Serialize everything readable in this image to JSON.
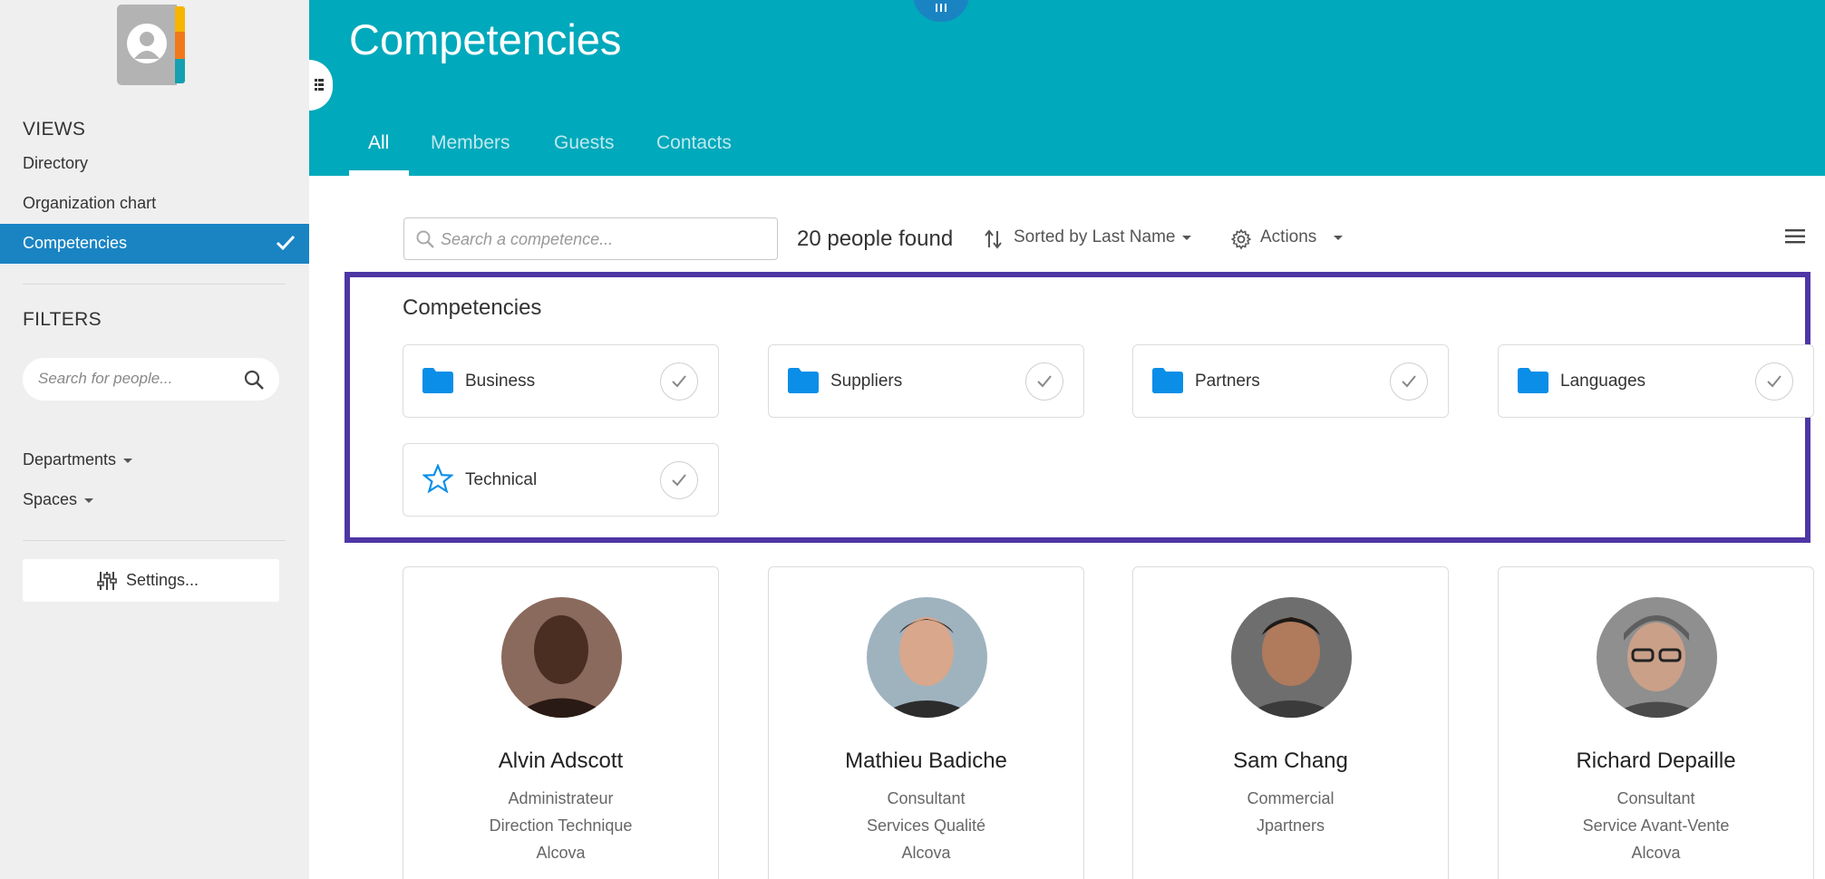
{
  "sidebar": {
    "views_heading": "VIEWS",
    "views": [
      {
        "label": "Directory"
      },
      {
        "label": "Organization chart"
      },
      {
        "label": "Competencies",
        "active": true
      }
    ],
    "filters_heading": "FILTERS",
    "search_placeholder": "Search for people...",
    "dropdowns": [
      {
        "label": "Departments"
      },
      {
        "label": "Spaces"
      }
    ],
    "settings_label": "Settings..."
  },
  "header": {
    "title": "Competencies",
    "tabs": [
      {
        "label": "All",
        "active": true
      },
      {
        "label": "Members"
      },
      {
        "label": "Guests"
      },
      {
        "label": "Contacts"
      }
    ]
  },
  "toolbar": {
    "search_placeholder": "Search a competence...",
    "count_text": "20 people found",
    "sort_label": "Sorted by Last Name",
    "actions_label": "Actions"
  },
  "competencies": {
    "title": "Competencies",
    "items": [
      {
        "label": "Business",
        "icon": "folder-icon"
      },
      {
        "label": "Suppliers",
        "icon": "folder-icon"
      },
      {
        "label": "Partners",
        "icon": "folder-icon"
      },
      {
        "label": "Languages",
        "icon": "folder-icon"
      },
      {
        "label": "Technical",
        "icon": "star-icon"
      }
    ]
  },
  "people": [
    {
      "name": "Alvin Adscott",
      "lines": [
        "Administrateur",
        "Direction Technique",
        "Alcova"
      ]
    },
    {
      "name": "Mathieu Badiche",
      "lines": [
        "Consultant",
        "Services Qualité",
        "Alcova"
      ]
    },
    {
      "name": "Sam Chang",
      "lines": [
        "Commercial",
        "Jpartners"
      ]
    },
    {
      "name": "Richard Depaille",
      "lines": [
        "Consultant",
        "Service Avant-Vente",
        "Alcova"
      ]
    }
  ],
  "colors": {
    "header": "#00a9bb",
    "sidebar_active": "#1a84c3",
    "sidebar_bg": "#efefef",
    "folder": "#0a8ee8",
    "highlight": "#4e36a4"
  }
}
